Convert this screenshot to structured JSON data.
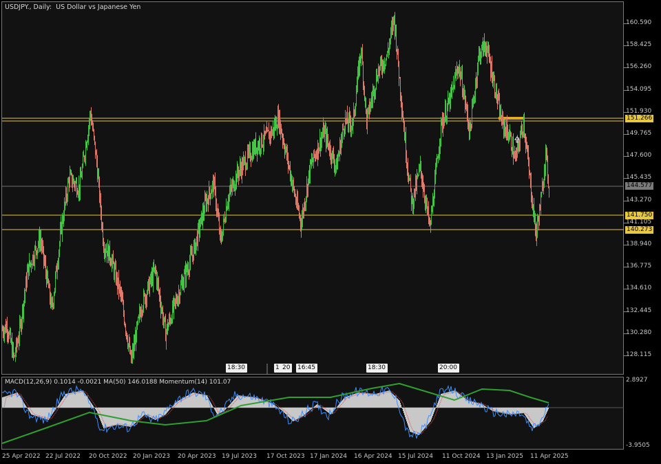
{
  "main_chart": {
    "title": "USDJPY., Daily:  US Dollar vs Japanese Yen",
    "price_levels": [
      "160.590",
      "158.425",
      "156.260",
      "154.095",
      "151.930",
      "149.765",
      "147.600",
      "145.435",
      "143.270",
      "141.105",
      "138.940",
      "136.775",
      "134.610",
      "132.445",
      "130.280",
      "128.115"
    ],
    "tags": {
      "current": "144.577",
      "line_a": "151.266",
      "line_b": "141.750",
      "line_c": "140.273"
    },
    "time_flags": [
      "18:30",
      "1",
      "20",
      "16:45",
      "18:30",
      "20:00"
    ],
    "colors": {
      "bull": "#3fbf3f",
      "bear": "#e07a6a",
      "level": "#e8c840",
      "current": "#707070"
    }
  },
  "indicator": {
    "title": "MACD(12,26,9) 0.1014 -0.0021 MA(50) 146.0188 Momentum(14) 101.07",
    "levels": [
      "2.8927",
      "-3.9505"
    ],
    "colors": {
      "histogram": "#c8c8c8",
      "signal": "#e05050",
      "macd": "#3d8fff",
      "ma": "#2fa02f"
    }
  },
  "time_axis": [
    "25 Apr 2022",
    "22 Jul 2022",
    "20 Oct 2022",
    "20 Jan 2023",
    "20 Apr 2023",
    "19 Jul 2023",
    "17 Oct 2023",
    "17 Jan 2024",
    "16 Apr 2024",
    "15 Jul 2024",
    "11 Oct 2024",
    "13 Jan 2025",
    "11 Apr 2025"
  ],
  "chart_data": {
    "type": "line",
    "title": "USDJPY., Daily:  US Dollar vs Japanese Yen",
    "x": [
      "25 Apr 2022",
      "22 Jul 2022",
      "20 Oct 2022",
      "20 Jan 2023",
      "20 Apr 2023",
      "19 Jul 2023",
      "17 Oct 2023",
      "17 Jan 2024",
      "16 Apr 2024",
      "15 Jul 2024",
      "11 Oct 2024",
      "13 Jan 2025",
      "11 Apr 2025"
    ],
    "series": [
      {
        "values": [
          130.5,
          136.5,
          151.0,
          130.5,
          134.5,
          141.0,
          149.5,
          147.5,
          155.0,
          158.0,
          148.5,
          157.5,
          144.5
        ]
      }
    ],
    "ylim": [
      127.0,
      162.5
    ],
    "grid": false
  }
}
